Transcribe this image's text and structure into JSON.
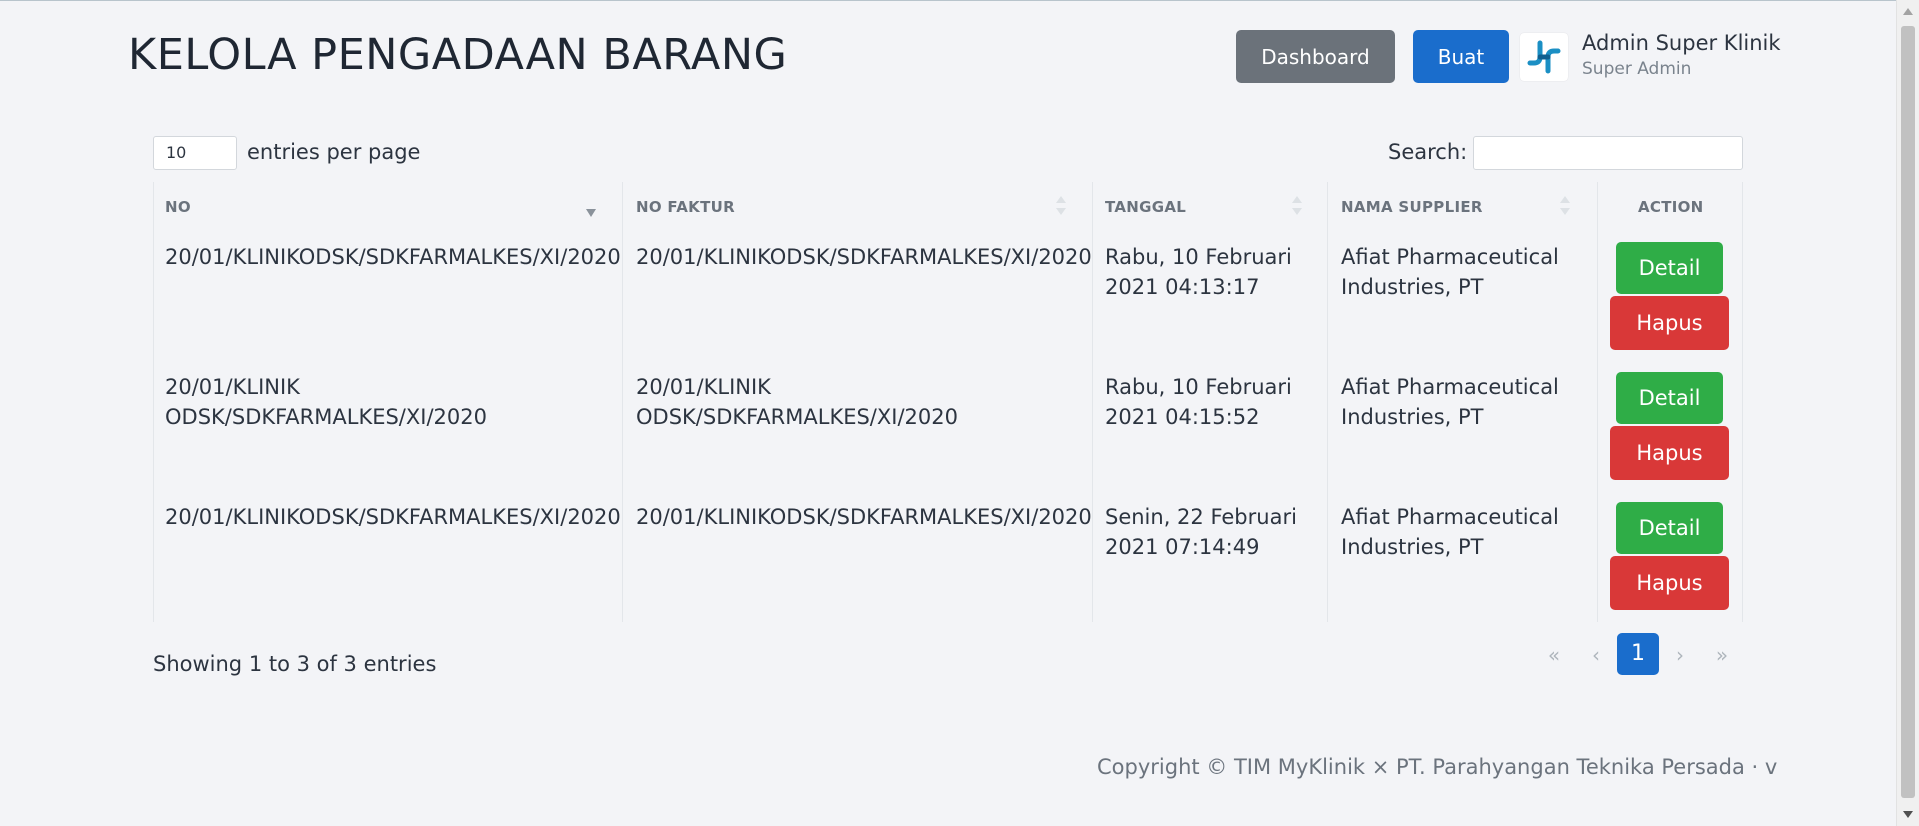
{
  "header": {
    "title": "KELOLA PENGADAAN BARANG",
    "dashboard_label": "Dashboard",
    "buat_label": "Buat",
    "user_name": "Admin Super Klinik",
    "user_role": "Super Admin"
  },
  "controls": {
    "entries_value": "10",
    "entries_label": "entries per page",
    "search_label": "Search:",
    "search_value": ""
  },
  "table": {
    "columns": [
      "NO",
      "NO FAKTUR",
      "TANGGAL",
      "NAMA SUPPLIER",
      "ACTION"
    ],
    "rows": [
      {
        "no": "20/01/KLINIKODSK/SDKFARMALKES/XI/2020",
        "faktur": "20/01/KLINIKODSK/SDKFARMALKES/XI/2020",
        "tanggal": "Rabu, 10 Februari 2021 04:13:17",
        "supplier": "Afiat Pharmaceutical Industries, PT",
        "detail_label": "Detail",
        "hapus_label": "Hapus"
      },
      {
        "no": "20/01/KLINIK ODSK/SDKFARMALKES/XI/2020",
        "faktur": "20/01/KLINIK ODSK/SDKFARMALKES/XI/2020",
        "tanggal": "Rabu, 10 Februari 2021 04:15:52",
        "supplier": "Afiat Pharmaceutical Industries, PT",
        "detail_label": "Detail",
        "hapus_label": "Hapus"
      },
      {
        "no": "20/01/KLINIKODSK/SDKFARMALKES/XI/2020",
        "faktur": "20/01/KLINIKODSK/SDKFARMALKES/XI/2020",
        "tanggal": "Senin, 22 Februari 2021 07:14:49",
        "supplier": "Afiat Pharmaceutical Industries, PT",
        "detail_label": "Detail",
        "hapus_label": "Hapus"
      }
    ]
  },
  "pagination": {
    "info": "Showing 1 to 3 of 3 entries",
    "first": "«",
    "prev": "‹",
    "current": "1",
    "next": "›",
    "last": "»"
  },
  "footer": {
    "copyright": "Copyright © TIM MyKlinik × PT. Parahyangan Teknika Persada · v"
  },
  "colors": {
    "primary": "#1a6dcc",
    "secondary": "#6b727a",
    "success": "#2fad47",
    "danger": "#d93838",
    "background": "#f3f4f7"
  },
  "icons": {
    "logo": "myklinik-logo-icon",
    "sort": "sort-arrows-icon",
    "sort_active": "sort-desc-icon"
  }
}
